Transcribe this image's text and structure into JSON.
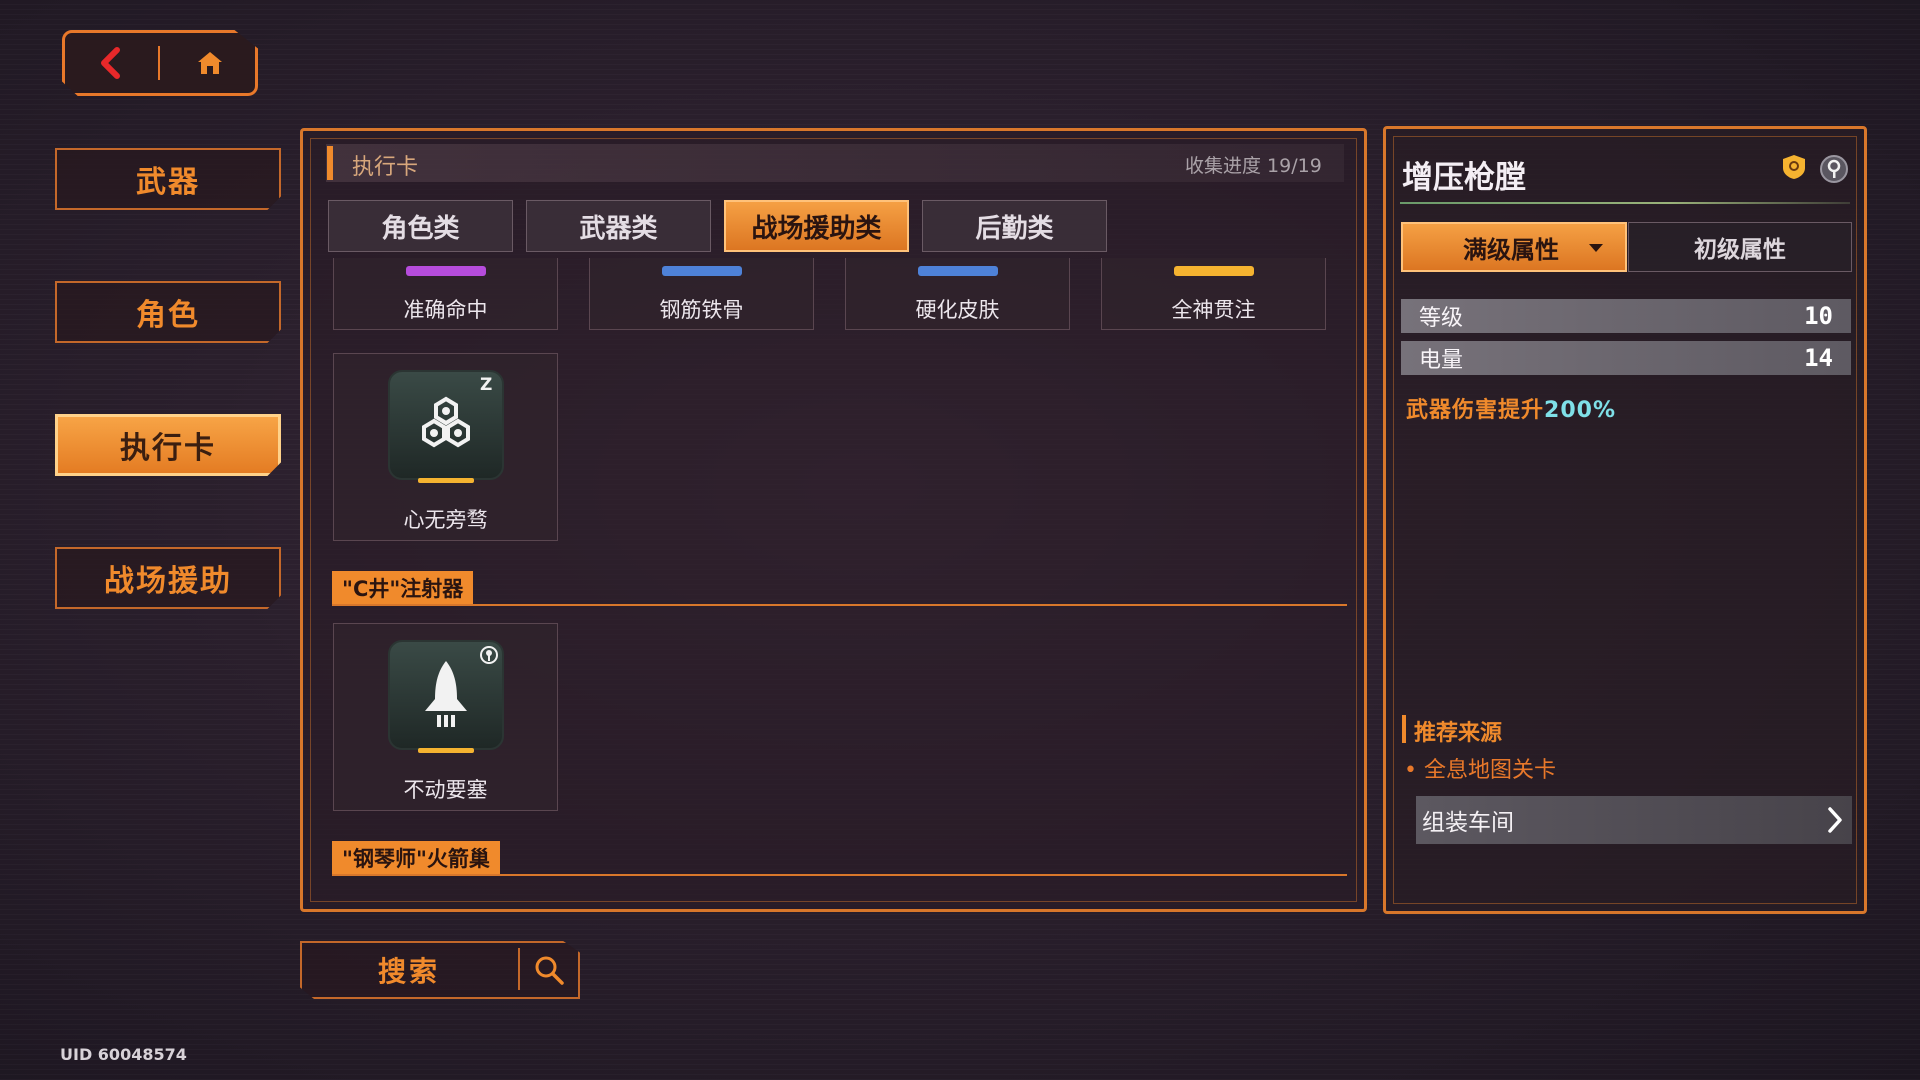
{
  "nav": {
    "categories": [
      {
        "label": "武器"
      },
      {
        "label": "角色"
      },
      {
        "label": "执行卡"
      },
      {
        "label": "战场援助"
      }
    ]
  },
  "panel": {
    "title": "执行卡",
    "progress": "收集进度 19/19",
    "tabs": [
      {
        "label": "角色类"
      },
      {
        "label": "武器类"
      },
      {
        "label": "战场援助类"
      },
      {
        "label": "后勤类"
      }
    ],
    "top_cards": [
      {
        "name": "准确命中",
        "color": "#b64cdc"
      },
      {
        "name": "钢筋铁骨",
        "color": "#4e82d8"
      },
      {
        "name": "硬化皮肤",
        "color": "#4e82d8"
      },
      {
        "name": "全神贯注",
        "color": "#f5b330"
      }
    ],
    "card_1": {
      "name": "心无旁骛",
      "badge": "Z"
    },
    "section_1": "\"C井\"注射器",
    "card_2": {
      "name": "不动要塞"
    },
    "section_2": "\"钢琴师\"火箭巢"
  },
  "detail": {
    "title": "增压枪膛",
    "tab_max": "满级属性",
    "tab_initial": "初级属性",
    "stats": [
      {
        "key": "等级",
        "value": "10"
      },
      {
        "key": "电量",
        "value": "14"
      }
    ],
    "effect_prefix": "武器伤害提升",
    "effect_value": "200%",
    "recommend_title": "推荐来源",
    "recommend_item": "• 全息地图关卡",
    "recommend_link": "组装车间"
  },
  "search": {
    "label": "搜索"
  },
  "uid": "UID 60048574",
  "colors": {
    "accent": "#f08a2c",
    "effect_value": "#7fe0e8"
  }
}
